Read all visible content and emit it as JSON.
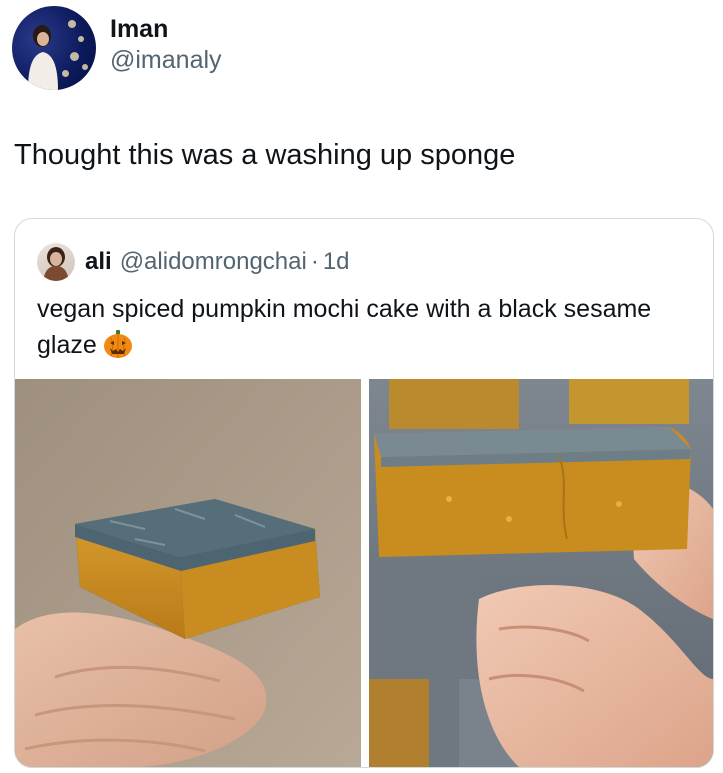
{
  "tweet": {
    "display_name": "Iman",
    "handle": "@imanaly",
    "text": "Thought this was a washing up sponge",
    "avatar_icon": "profile-photo"
  },
  "quoted_tweet": {
    "display_name": "ali",
    "handle": "@alidomrongchai",
    "separator": "·",
    "time": "1d",
    "text": "vegan spiced pumpkin mochi cake with a black sesame glaze",
    "emoji": "jack-o-lantern",
    "images": [
      {
        "description_icon": "mochi-cake-photo-whole"
      },
      {
        "description_icon": "mochi-cake-photo-bitten"
      }
    ]
  },
  "colors": {
    "text_primary": "#0f1419",
    "text_secondary": "#536471",
    "border": "#cfd9de"
  }
}
